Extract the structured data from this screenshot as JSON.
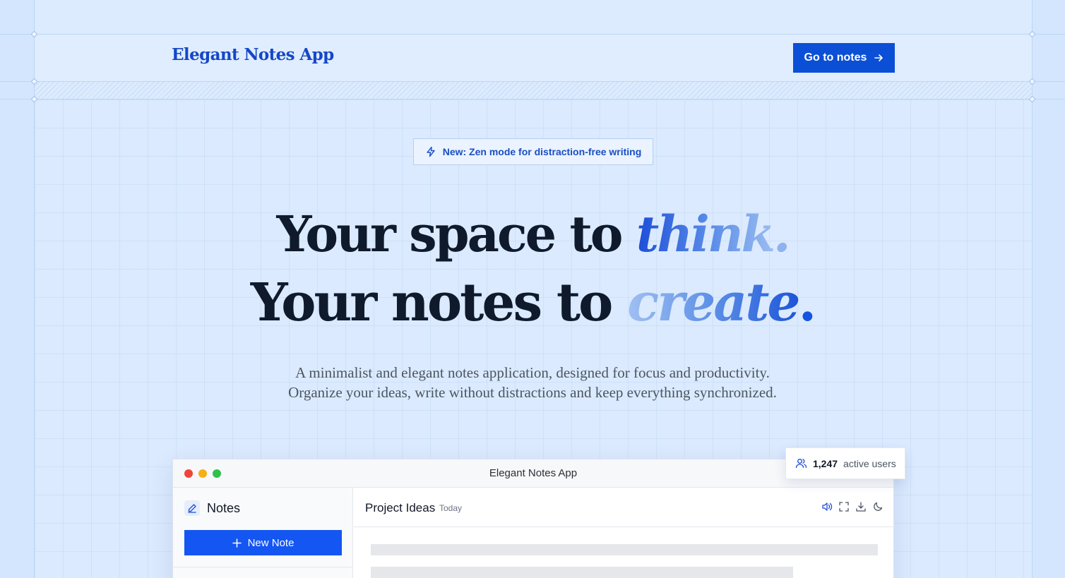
{
  "header": {
    "logo": "Elegant Notes App",
    "cta_label": "Go to notes"
  },
  "badge": {
    "icon": "lightning-icon",
    "text": "New: Zen mode for distraction-free writing"
  },
  "hero": {
    "line1_prefix": "Your space to ",
    "line1_accent": "think",
    "line1_dot": ".",
    "line2_prefix": "Your notes to ",
    "line2_accent": "create",
    "line2_dot": ".",
    "subtitle_line1": "A minimalist and elegant notes application, designed for focus and productivity.",
    "subtitle_line2": "Organize your ideas, write without distractions and keep everything synchronized."
  },
  "app_window": {
    "title": "Elegant Notes App",
    "sidebar": {
      "heading": "Notes",
      "new_note_label": "New Note"
    },
    "editor": {
      "doc_title": "Project Ideas",
      "doc_date": "Today",
      "tools": [
        "volume-icon",
        "fullscreen-icon",
        "download-icon",
        "moon-icon"
      ]
    }
  },
  "users_card": {
    "count": "1,247",
    "label": "active users"
  },
  "colors": {
    "brand": "#0b4fd6",
    "background": "#d3e6fd",
    "heading": "#0f1a2c"
  }
}
